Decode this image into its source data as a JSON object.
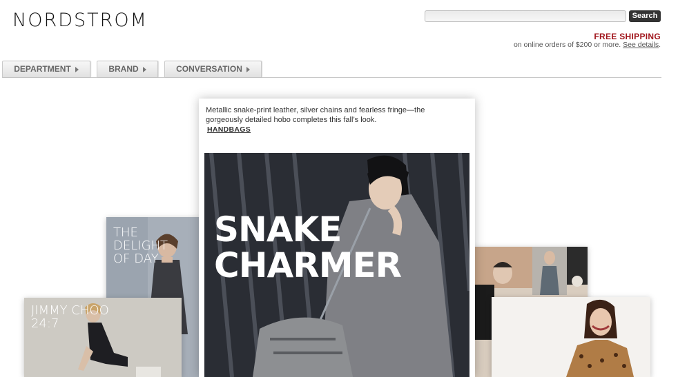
{
  "header": {
    "logo": "NORDSTROM",
    "search": {
      "placeholder": "",
      "button_label": "Search"
    },
    "shipping": {
      "title": "FREE SHIPPING",
      "subtitle": "on online orders of $200 or more.",
      "link": "See details"
    }
  },
  "nav": {
    "tabs": [
      {
        "label": "DEPARTMENT"
      },
      {
        "label": "BRAND"
      },
      {
        "label": "CONVERSATION"
      }
    ]
  },
  "feature": {
    "description": "Metallic snake-print leather, silver chains and fearless fringe—the gorgeously detailed hobo completes this fall’s look.",
    "link": "HANDBAGS",
    "headline_line1": "SNAKE",
    "headline_line2": "CHARMER"
  },
  "cards": {
    "delight": {
      "line1": "THE",
      "line2": "DELIGHT",
      "line3": "OF DAY"
    },
    "jimmy": {
      "line1": "JIMMY CHOO",
      "line2": "24:7"
    }
  },
  "icons": {
    "tab_arrow": "triangle-right-icon"
  }
}
